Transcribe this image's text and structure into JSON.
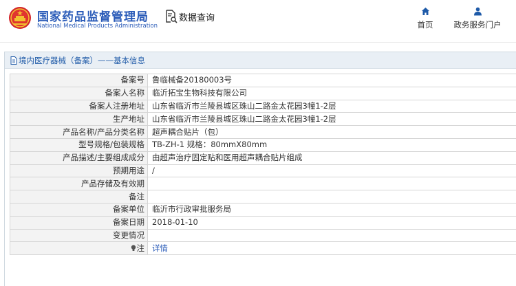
{
  "header": {
    "brand_cn": "国家药品监督管理局",
    "brand_en": "National Medical Products Administration",
    "query_label": "数据查询",
    "nav": [
      {
        "label": "首页",
        "icon": "home-icon"
      },
      {
        "label": "政务服务门户",
        "icon": "user-icon"
      }
    ]
  },
  "panel": {
    "title": "境内医疗器械（备案）——基本信息"
  },
  "rows": [
    {
      "label": "备案号",
      "value": "鲁临械备20180003号"
    },
    {
      "label": "备案人名称",
      "value": "临沂拓宝生物科技有限公司"
    },
    {
      "label": "备案人注册地址",
      "value": "山东省临沂市兰陵县城区珠山二路金太花园3幢1-2层"
    },
    {
      "label": "生产地址",
      "value": "山东省临沂市兰陵县城区珠山二路金太花园3幢1-2层"
    },
    {
      "label": "产品名称/产品分类名称",
      "value": "超声耦合贴片（包）"
    },
    {
      "label": "型号规格/包装规格",
      "value": "TB-ZH-1 规格：80mmX80mm"
    },
    {
      "label": "产品描述/主要组成成分",
      "value": "由超声治疗固定贴和医用超声耦合贴片组成"
    },
    {
      "label": "预期用途",
      "value": "/"
    },
    {
      "label": "产品存储及有效期",
      "value": ""
    },
    {
      "label": "备注",
      "value": ""
    },
    {
      "label": "备案单位",
      "value": "临沂市行政审批服务局"
    },
    {
      "label": "备案日期",
      "value": "2018-01-10"
    },
    {
      "label": "变更情况",
      "value": ""
    }
  ],
  "note": {
    "label": "注",
    "link": "详情"
  },
  "colors": {
    "brand_blue": "#2a5bb8",
    "emblem_red": "#d4252b",
    "emblem_gold": "#f2c230"
  }
}
